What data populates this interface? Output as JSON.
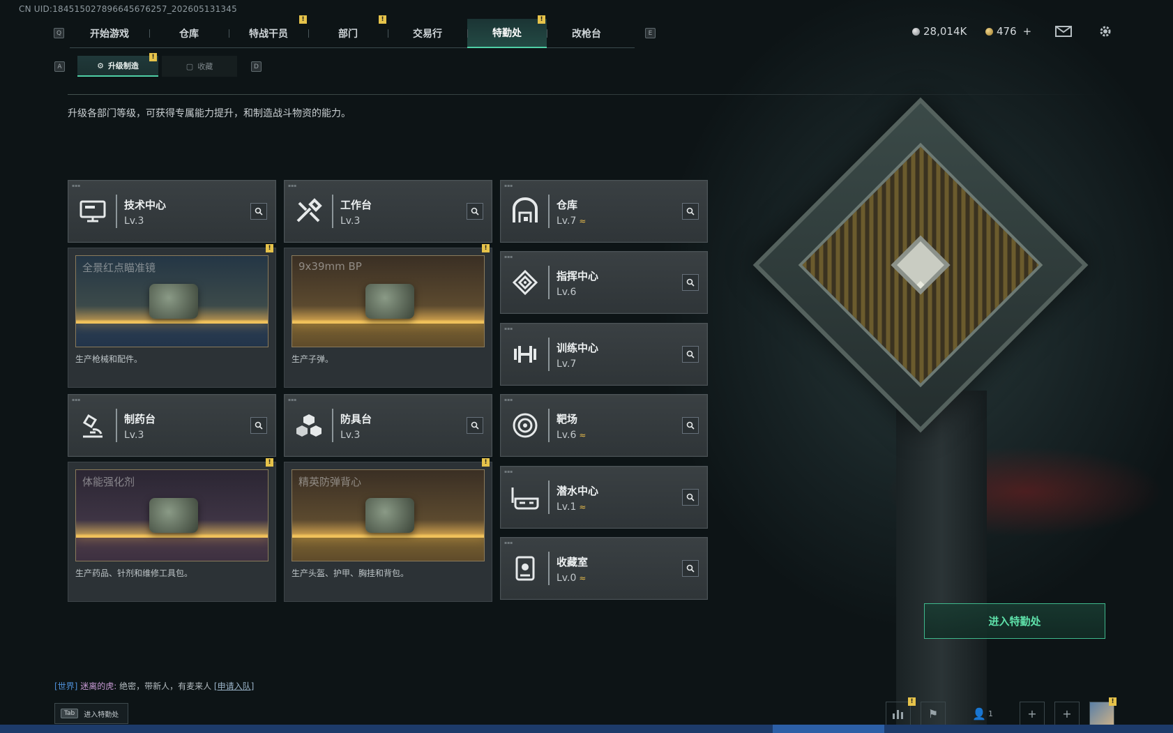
{
  "uid": "CN UID:184515027896645676257_202605131345",
  "nav": {
    "left_key": "Q",
    "right_key": "E",
    "tabs": [
      {
        "label": "开始游戏",
        "badge": ""
      },
      {
        "label": "仓库",
        "badge": ""
      },
      {
        "label": "特战干员",
        "badge": "!"
      },
      {
        "label": "部门",
        "badge": "!"
      },
      {
        "label": "交易行",
        "badge": ""
      },
      {
        "label": "特勤处",
        "badge": "!",
        "active": true
      },
      {
        "label": "改枪台",
        "badge": ""
      }
    ]
  },
  "currency": {
    "silver": "28,014K",
    "gold": "476",
    "plus": "+"
  },
  "subtabs": {
    "left_key": "A",
    "right_key": "D",
    "upgrade": "升级制造",
    "upgrade_badge": "!",
    "collect": "收藏"
  },
  "description": "升级各部门等级，可获得专属能力提升，和制造战斗物资的能力。",
  "left_cards": [
    {
      "name": "技术中心",
      "lv": "Lv.3",
      "upgrade": false,
      "icon": "monitor-icon",
      "product": "全景红点瞄准镜",
      "product_desc": "生产枪械和配件。",
      "badge": "!",
      "theme": "blue"
    },
    {
      "name": "工作台",
      "lv": "Lv.3",
      "upgrade": false,
      "icon": "tools-icon",
      "product": "9x39mm BP",
      "product_desc": "生产子弹。",
      "badge": "!",
      "theme": "brown"
    },
    {
      "name": "制药台",
      "lv": "Lv.3",
      "upgrade": false,
      "icon": "microscope-icon",
      "product": "体能强化剂",
      "product_desc": "生产药品、针剂和维修工具包。",
      "badge": "!",
      "theme": "purple"
    },
    {
      "name": "防具台",
      "lv": "Lv.3",
      "upgrade": false,
      "icon": "cubes-icon",
      "product": "精英防弹背心",
      "product_desc": "生产头盔、护甲、胸挂和背包。",
      "badge": "!",
      "theme": "brown"
    }
  ],
  "right_cards": [
    {
      "name": "仓库",
      "lv": "Lv.7",
      "upgrade": true,
      "icon": "warehouse-icon"
    },
    {
      "name": "指挥中心",
      "lv": "Lv.6",
      "upgrade": false,
      "icon": "command-icon"
    },
    {
      "name": "训练中心",
      "lv": "Lv.7",
      "upgrade": false,
      "icon": "dumbbell-icon"
    },
    {
      "name": "靶场",
      "lv": "Lv.6",
      "upgrade": true,
      "icon": "target-icon"
    },
    {
      "name": "潜水中心",
      "lv": "Lv.1",
      "upgrade": true,
      "icon": "diving-mask-icon"
    },
    {
      "name": "收藏室",
      "lv": "Lv.0",
      "upgrade": true,
      "icon": "collection-icon"
    }
  ],
  "upgrade_symbol": "≈",
  "enter_button": "进入特勤处",
  "chat": {
    "channel": "[世界]",
    "who": "迷离的虎:",
    "msg": "绝密，带新人，有麦来人",
    "join": "[申请入队]"
  },
  "tab_hint": {
    "key": "Tab",
    "label": "进入特勤处"
  },
  "friends_count": "1"
}
